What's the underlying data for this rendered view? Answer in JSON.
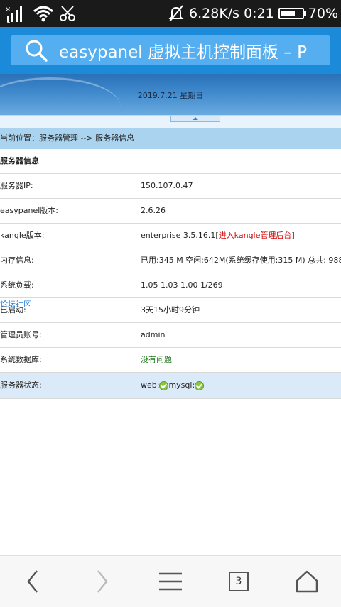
{
  "status_bar": {
    "speed": "6.28K/s",
    "time": "0:21",
    "battery_percent": "70%",
    "battery_level": 0.7
  },
  "browser": {
    "url_text": "easypanel 虚拟主机控制面板 – P",
    "tab_count": "3"
  },
  "banner": {
    "date": "2019.7.21 星期日"
  },
  "breadcrumb": "当前位置：服务器管理 --> 服务器信息",
  "table": {
    "header": "服务器信息",
    "rows": [
      {
        "label": "服务器IP:",
        "value": "150.107.0.47"
      },
      {
        "label": "easypanel版本:",
        "value": "2.6.26"
      },
      {
        "label": "kangle版本:",
        "value": "enterprise 3.5.16.1",
        "link_open": "[",
        "link": "进入kangle管理后台",
        "link_close": "]"
      },
      {
        "label": "内存信息:",
        "value": "已用:345 M 空闲:642M(系统缓存使用:315 M) 总共: 988"
      },
      {
        "label": "系统负载:",
        "value": "1.05 1.03 1.00 1/269"
      },
      {
        "label": "已启动:",
        "value": "3天15小时9分钟"
      },
      {
        "label": "管理员账号:",
        "value": "admin"
      },
      {
        "label": "系统数据库:",
        "value": "没有问题"
      },
      {
        "label": "服务器状态:",
        "web": "web:",
        "mysql": "mysql:"
      }
    ]
  },
  "overlay_link": "论坛社区",
  "icons": {
    "back": "chevron-left-icon",
    "forward": "chevron-right-icon",
    "menu": "menu-icon",
    "tabs": "tabs-icon",
    "home": "home-icon"
  },
  "colors": {
    "status_bar": "#1a1a1a",
    "url_bar": "#1b8ad9",
    "breadcrumb_bg": "#a9d3ef",
    "link_red": "#d40000",
    "ok_green": "#1f7a1f"
  }
}
